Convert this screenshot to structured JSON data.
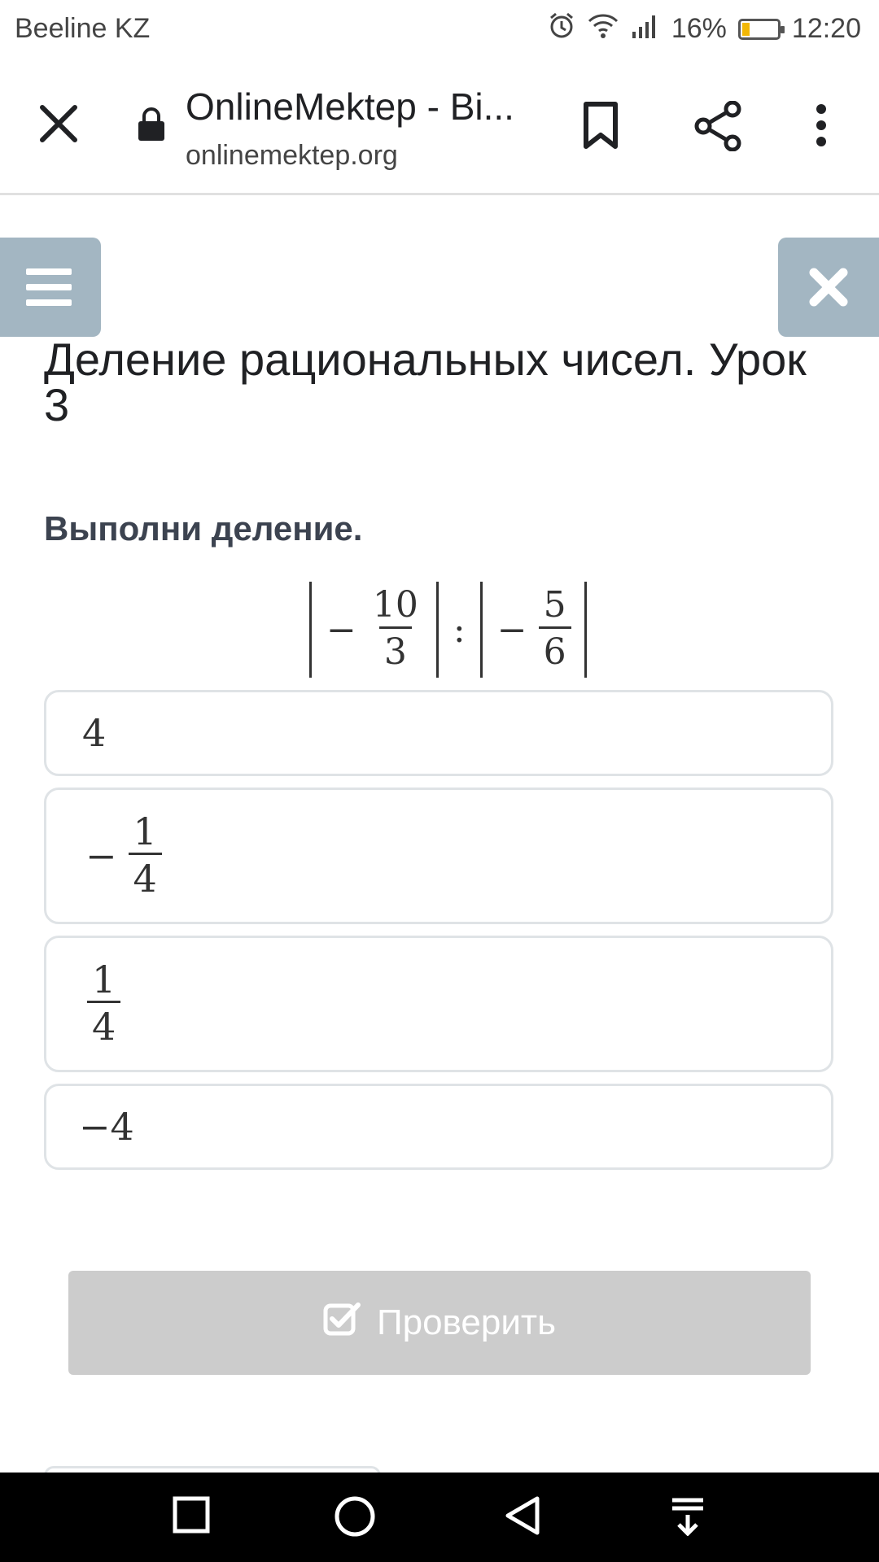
{
  "status_bar": {
    "carrier": "Beeline KZ",
    "battery": "16%",
    "time": "12:20",
    "icons": [
      "alarm-icon",
      "wifi-icon",
      "signal-icon",
      "battery-icon"
    ]
  },
  "browser": {
    "page_title": "OnlineMektep - Bi...",
    "url": "onlinemektep.org",
    "icons": [
      "close-icon",
      "lock-icon",
      "bookmark-icon",
      "share-icon",
      "more-vert-icon"
    ]
  },
  "lesson": {
    "title": "Деление рациональных чисел. Урок 3",
    "task": "Выполни деление.",
    "expression": {
      "left_sign": "−",
      "left_num": "10",
      "left_den": "3",
      "operator": ":",
      "right_sign": "−",
      "right_num": "5",
      "right_den": "6"
    }
  },
  "options": [
    {
      "text": "4"
    },
    {
      "sign": "−",
      "num": "1",
      "den": "4"
    },
    {
      "num": "1",
      "den": "4"
    },
    {
      "text": "−4"
    }
  ],
  "check_button": {
    "label": "Проверить",
    "icon": "checkbox-icon"
  },
  "nav_bar": {
    "icons": [
      "recent-apps-icon",
      "home-icon",
      "back-icon",
      "notifications-pull-icon"
    ]
  }
}
